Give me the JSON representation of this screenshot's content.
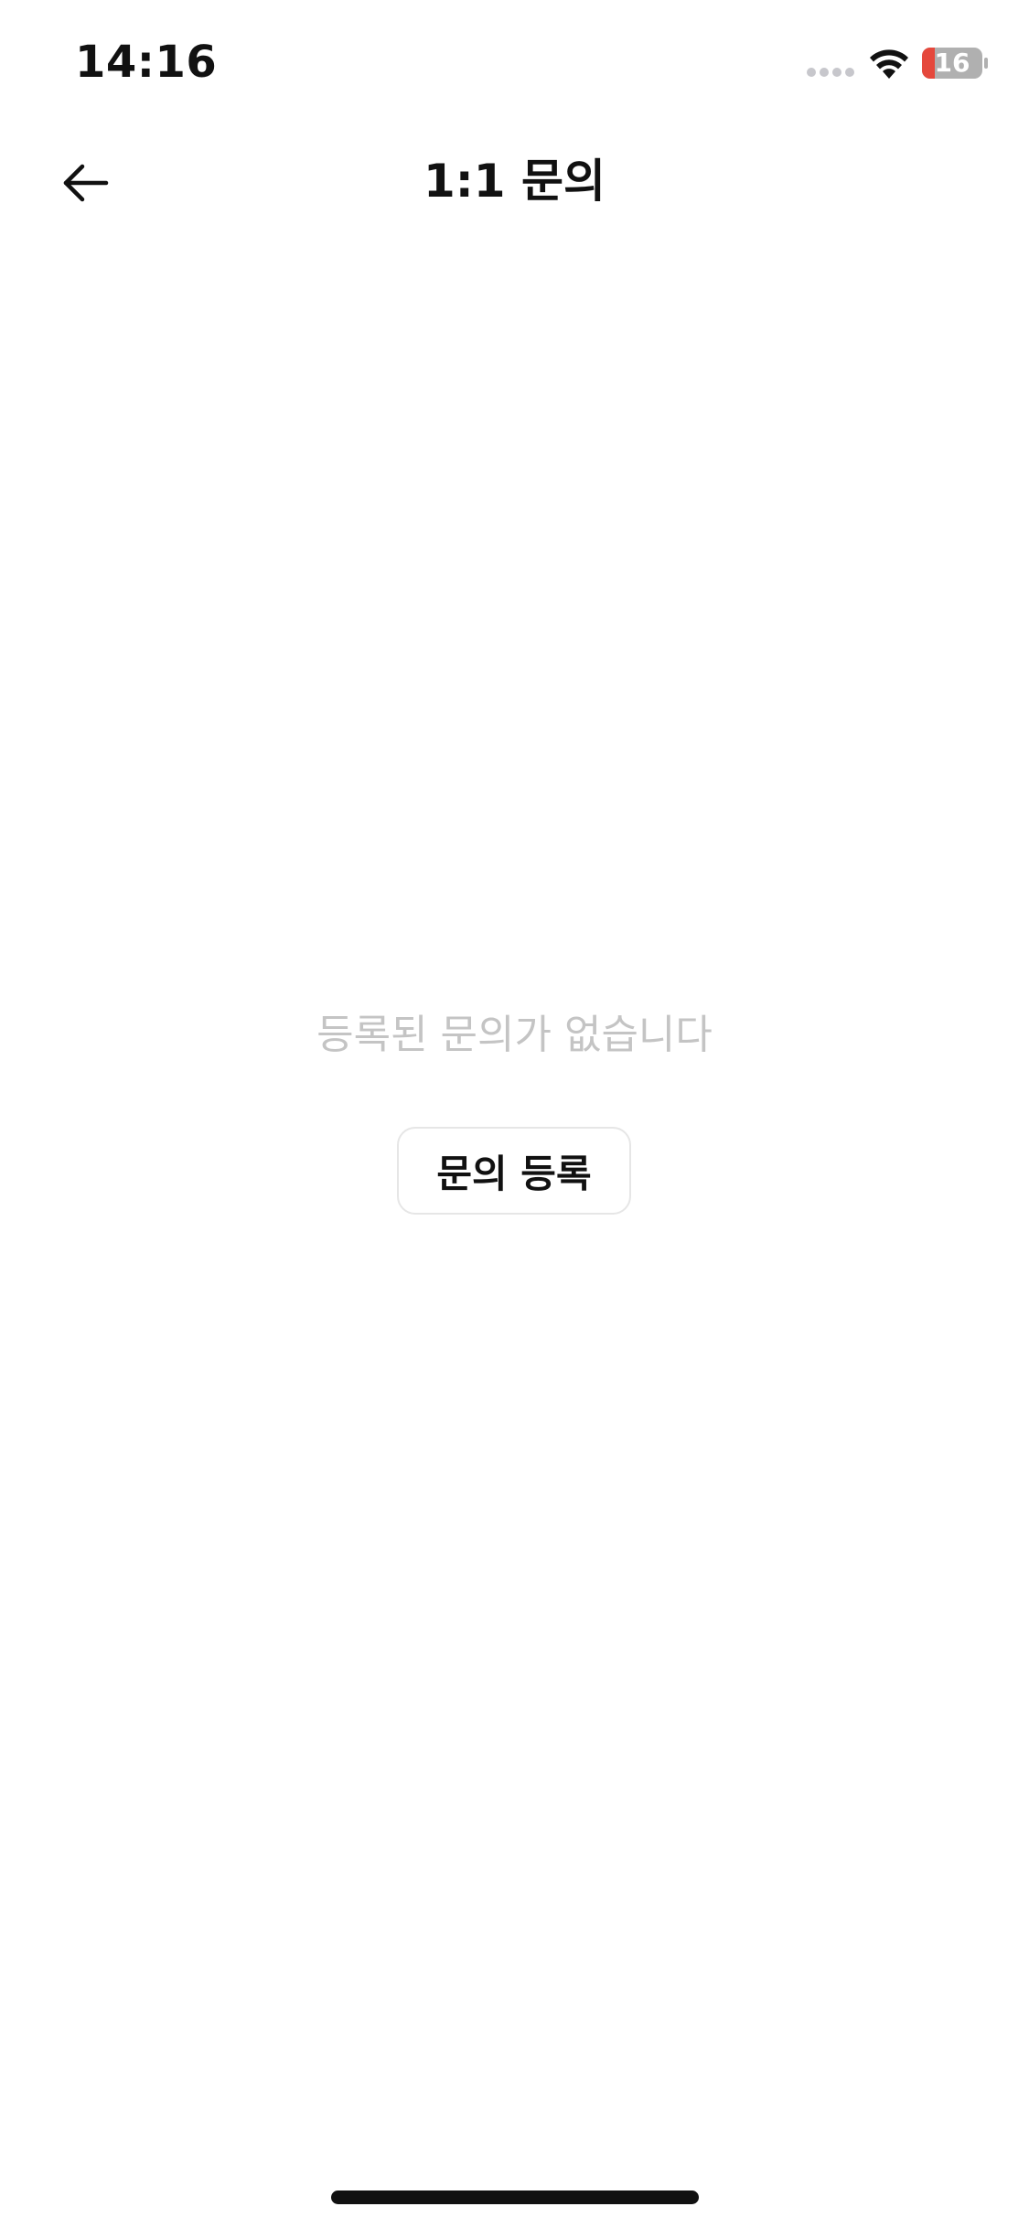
{
  "status_bar": {
    "time": "14:16",
    "battery_level": "16"
  },
  "header": {
    "title": "1:1 문의"
  },
  "empty_state": {
    "message": "등록된 문의가 없습니다",
    "register_button_label": "문의 등록"
  },
  "icons": {
    "back": "arrow-left-icon",
    "signal": "cellular-signal-icon",
    "wifi": "wifi-icon",
    "battery": "battery-icon"
  },
  "colors": {
    "background": "#ffffff",
    "text_primary": "#111111",
    "text_placeholder": "#c4c4c4",
    "button_border": "#e6e6e6",
    "battery_low": "#e5483c",
    "battery_body": "#b0b0b0"
  }
}
